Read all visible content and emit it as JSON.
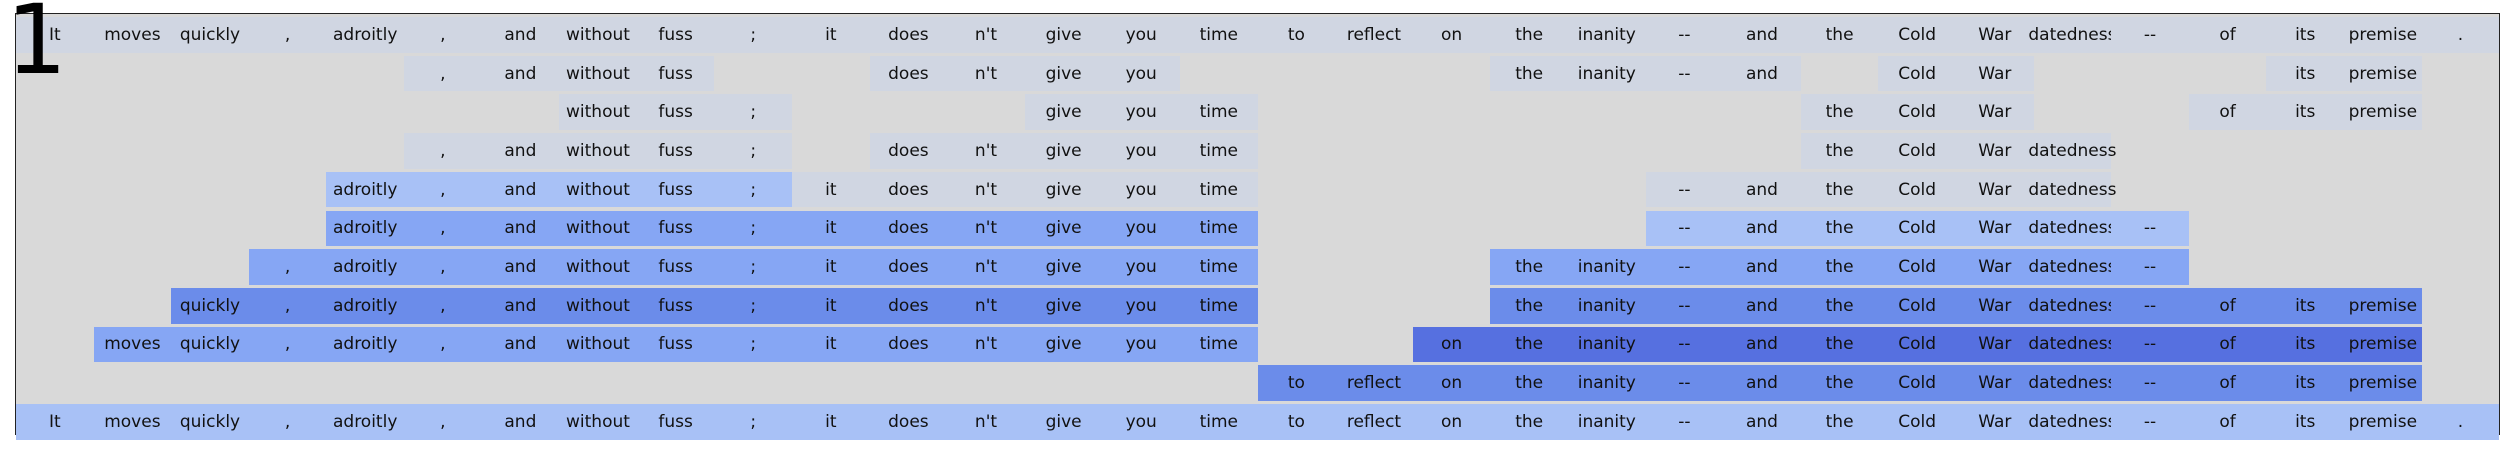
{
  "panel_label": "1",
  "colors": {
    "background": "#d9d9d9",
    "level": [
      "#d0d6e2",
      "#a8c1f6",
      "#86a6f4",
      "#6b8cea",
      "#5670e0"
    ]
  },
  "tokens": [
    "It",
    "moves",
    "quickly",
    ",",
    "adroitly",
    ",",
    "and",
    "without",
    "fuss",
    ";",
    "it",
    "does",
    "n't",
    "give",
    "you",
    "time",
    "to",
    "reflect",
    "on",
    "the",
    "inanity",
    "--",
    "and",
    "the",
    "Cold",
    "War",
    "datedness",
    "--",
    "of",
    "its",
    "premise",
    "."
  ],
  "rows": [
    {
      "cells": [
        [
          0,
          0
        ],
        [
          1,
          0
        ],
        [
          2,
          0
        ],
        [
          3,
          0
        ],
        [
          4,
          0
        ],
        [
          5,
          0
        ],
        [
          6,
          0
        ],
        [
          7,
          0
        ],
        [
          8,
          0
        ],
        [
          9,
          0
        ],
        [
          10,
          0
        ],
        [
          11,
          0
        ],
        [
          12,
          0
        ],
        [
          13,
          0
        ],
        [
          14,
          0
        ],
        [
          15,
          0
        ],
        [
          16,
          0
        ],
        [
          17,
          0
        ],
        [
          18,
          0
        ],
        [
          19,
          0
        ],
        [
          20,
          0
        ],
        [
          21,
          0
        ],
        [
          22,
          0
        ],
        [
          23,
          0
        ],
        [
          24,
          0
        ],
        [
          25,
          0
        ],
        [
          26,
          0
        ],
        [
          27,
          0
        ],
        [
          28,
          0
        ],
        [
          29,
          0
        ],
        [
          30,
          0
        ],
        [
          31,
          0
        ]
      ]
    },
    {
      "cells": [
        [
          5,
          0
        ],
        [
          6,
          0
        ],
        [
          7,
          0
        ],
        [
          8,
          0
        ],
        [
          11,
          0
        ],
        [
          12,
          0
        ],
        [
          13,
          0
        ],
        [
          14,
          0
        ],
        [
          19,
          0
        ],
        [
          20,
          0
        ],
        [
          21,
          0
        ],
        [
          22,
          0
        ],
        [
          24,
          0
        ],
        [
          25,
          0
        ],
        [
          29,
          0
        ],
        [
          30,
          0
        ]
      ]
    },
    {
      "cells": [
        [
          7,
          0
        ],
        [
          8,
          0
        ],
        [
          9,
          0
        ],
        [
          13,
          0
        ],
        [
          14,
          0
        ],
        [
          15,
          0
        ],
        [
          23,
          0
        ],
        [
          24,
          0
        ],
        [
          25,
          0
        ],
        [
          28,
          0
        ],
        [
          29,
          0
        ],
        [
          30,
          0
        ]
      ]
    },
    {
      "cells": [
        [
          5,
          0
        ],
        [
          6,
          0
        ],
        [
          7,
          0
        ],
        [
          8,
          0
        ],
        [
          9,
          0
        ],
        [
          11,
          0
        ],
        [
          12,
          0
        ],
        [
          13,
          0
        ],
        [
          14,
          0
        ],
        [
          15,
          0
        ],
        [
          23,
          0
        ],
        [
          24,
          0
        ],
        [
          25,
          0
        ],
        [
          26,
          0
        ]
      ]
    },
    {
      "cells": [
        [
          4,
          1
        ],
        [
          5,
          1
        ],
        [
          6,
          1
        ],
        [
          7,
          1
        ],
        [
          8,
          1
        ],
        [
          9,
          1
        ],
        [
          10,
          0
        ],
        [
          11,
          0
        ],
        [
          12,
          0
        ],
        [
          13,
          0
        ],
        [
          14,
          0
        ],
        [
          15,
          0
        ],
        [
          21,
          0
        ],
        [
          22,
          0
        ],
        [
          23,
          0
        ],
        [
          24,
          0
        ],
        [
          25,
          0
        ],
        [
          26,
          0
        ]
      ]
    },
    {
      "cells": [
        [
          4,
          2
        ],
        [
          5,
          2
        ],
        [
          6,
          2
        ],
        [
          7,
          2
        ],
        [
          8,
          2
        ],
        [
          9,
          2
        ],
        [
          10,
          2
        ],
        [
          11,
          2
        ],
        [
          12,
          2
        ],
        [
          13,
          2
        ],
        [
          14,
          2
        ],
        [
          15,
          2
        ],
        [
          21,
          1
        ],
        [
          22,
          1
        ],
        [
          23,
          1
        ],
        [
          24,
          1
        ],
        [
          25,
          1
        ],
        [
          26,
          1
        ],
        [
          27,
          1
        ]
      ]
    },
    {
      "cells": [
        [
          3,
          2
        ],
        [
          4,
          2
        ],
        [
          5,
          2
        ],
        [
          6,
          2
        ],
        [
          7,
          2
        ],
        [
          8,
          2
        ],
        [
          9,
          2
        ],
        [
          10,
          2
        ],
        [
          11,
          2
        ],
        [
          12,
          2
        ],
        [
          13,
          2
        ],
        [
          14,
          2
        ],
        [
          15,
          2
        ],
        [
          19,
          2
        ],
        [
          20,
          2
        ],
        [
          21,
          2
        ],
        [
          22,
          2
        ],
        [
          23,
          2
        ],
        [
          24,
          2
        ],
        [
          25,
          2
        ],
        [
          26,
          2
        ],
        [
          27,
          2
        ]
      ]
    },
    {
      "cells": [
        [
          2,
          3
        ],
        [
          3,
          3
        ],
        [
          4,
          3
        ],
        [
          5,
          3
        ],
        [
          6,
          3
        ],
        [
          7,
          3
        ],
        [
          8,
          3
        ],
        [
          9,
          3
        ],
        [
          10,
          3
        ],
        [
          11,
          3
        ],
        [
          12,
          3
        ],
        [
          13,
          3
        ],
        [
          14,
          3
        ],
        [
          15,
          3
        ],
        [
          19,
          3
        ],
        [
          20,
          3
        ],
        [
          21,
          3
        ],
        [
          22,
          3
        ],
        [
          23,
          3
        ],
        [
          24,
          3
        ],
        [
          25,
          3
        ],
        [
          26,
          3
        ],
        [
          27,
          3
        ],
        [
          28,
          3
        ],
        [
          29,
          3
        ],
        [
          30,
          3
        ]
      ]
    },
    {
      "cells": [
        [
          1,
          2
        ],
        [
          2,
          2
        ],
        [
          3,
          2
        ],
        [
          4,
          2
        ],
        [
          5,
          2
        ],
        [
          6,
          2
        ],
        [
          7,
          2
        ],
        [
          8,
          2
        ],
        [
          9,
          2
        ],
        [
          10,
          2
        ],
        [
          11,
          2
        ],
        [
          12,
          2
        ],
        [
          13,
          2
        ],
        [
          14,
          2
        ],
        [
          15,
          2
        ],
        [
          18,
          4
        ],
        [
          19,
          4
        ],
        [
          20,
          4
        ],
        [
          21,
          4
        ],
        [
          22,
          4
        ],
        [
          23,
          4
        ],
        [
          24,
          4
        ],
        [
          25,
          4
        ],
        [
          26,
          4
        ],
        [
          27,
          4
        ],
        [
          28,
          4
        ],
        [
          29,
          4
        ],
        [
          30,
          4
        ]
      ]
    },
    {
      "cells": [
        [
          16,
          3
        ],
        [
          17,
          3
        ],
        [
          18,
          3
        ],
        [
          19,
          3
        ],
        [
          20,
          3
        ],
        [
          21,
          3
        ],
        [
          22,
          3
        ],
        [
          23,
          3
        ],
        [
          24,
          3
        ],
        [
          25,
          3
        ],
        [
          26,
          3
        ],
        [
          27,
          3
        ],
        [
          28,
          3
        ],
        [
          29,
          3
        ],
        [
          30,
          3
        ]
      ]
    },
    {
      "cells": [
        [
          0,
          1
        ],
        [
          1,
          1
        ],
        [
          2,
          1
        ],
        [
          3,
          1
        ],
        [
          4,
          1
        ],
        [
          5,
          1
        ],
        [
          6,
          1
        ],
        [
          7,
          1
        ],
        [
          8,
          1
        ],
        [
          9,
          1
        ],
        [
          10,
          1
        ],
        [
          11,
          1
        ],
        [
          12,
          1
        ],
        [
          13,
          1
        ],
        [
          14,
          1
        ],
        [
          15,
          1
        ],
        [
          16,
          1
        ],
        [
          17,
          1
        ],
        [
          18,
          1
        ],
        [
          19,
          1
        ],
        [
          20,
          1
        ],
        [
          21,
          1
        ],
        [
          22,
          1
        ],
        [
          23,
          1
        ],
        [
          24,
          1
        ],
        [
          25,
          1
        ],
        [
          26,
          1
        ],
        [
          27,
          1
        ],
        [
          28,
          1
        ],
        [
          29,
          1
        ],
        [
          30,
          1
        ],
        [
          31,
          1
        ]
      ]
    }
  ]
}
